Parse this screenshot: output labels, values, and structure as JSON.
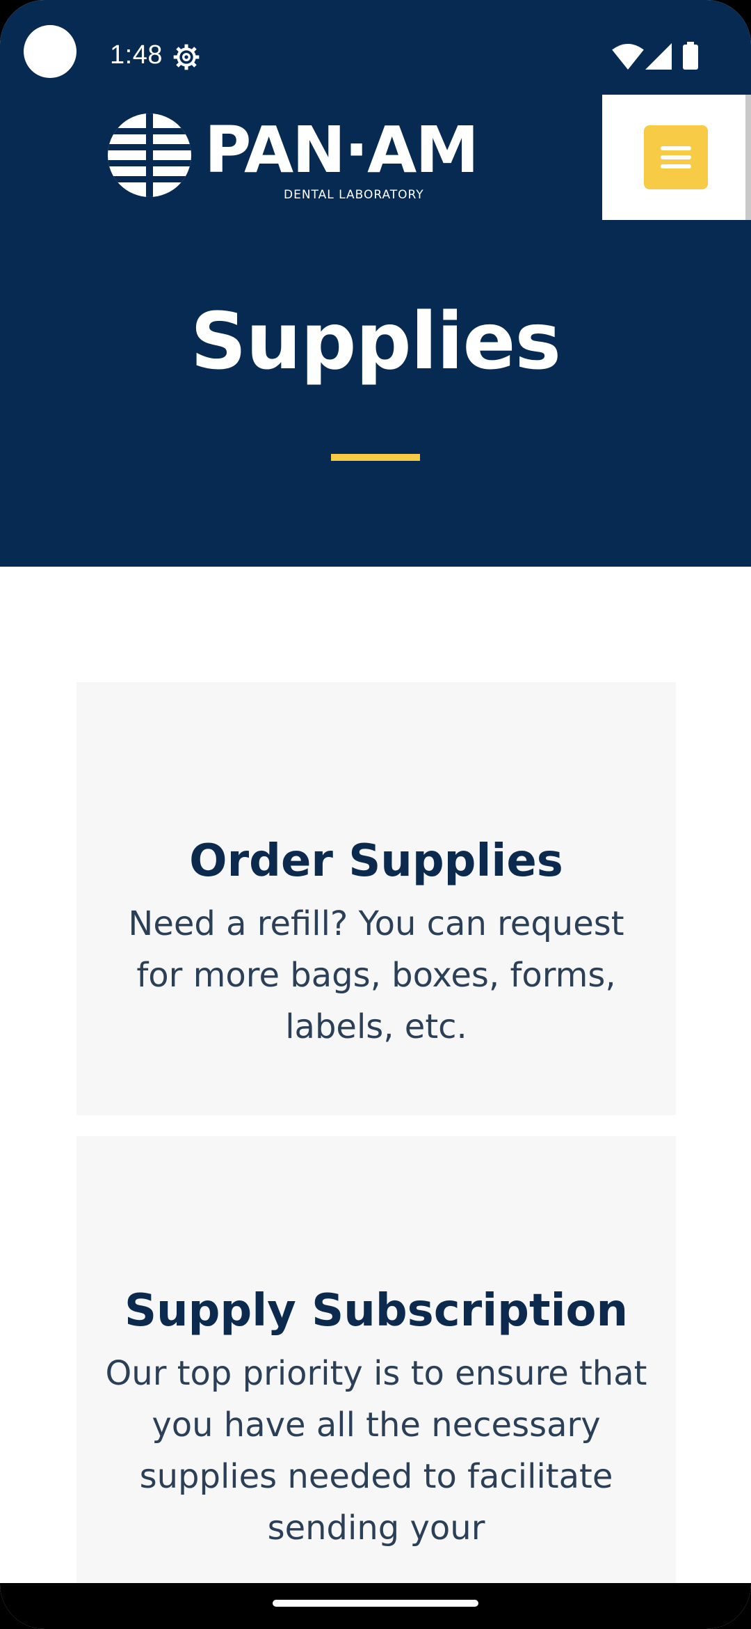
{
  "status_bar": {
    "time": "1:48",
    "icons": [
      "gear-icon",
      "wifi-icon",
      "signal-icon",
      "battery-icon"
    ]
  },
  "header": {
    "logo_word": "PAN·AM",
    "logo_sub": "DENTAL LABORATORY",
    "menu_icon": "hamburger-menu-icon"
  },
  "hero": {
    "title": "Supplies"
  },
  "cards": [
    {
      "title": "Order Supplies",
      "text": "Need a refill? You can request for more bags, boxes, forms, labels, etc."
    },
    {
      "title": "Supply Subscription",
      "text": "Our top priority is to ensure that you have all the necessary supplies needed to facilitate sending your"
    }
  ],
  "colors": {
    "navy": "#062a52",
    "accent_yellow": "#f8cb47",
    "card_bg": "#f7f7f8",
    "heading": "#0c2a4e",
    "body_text": "#2b3f57"
  }
}
